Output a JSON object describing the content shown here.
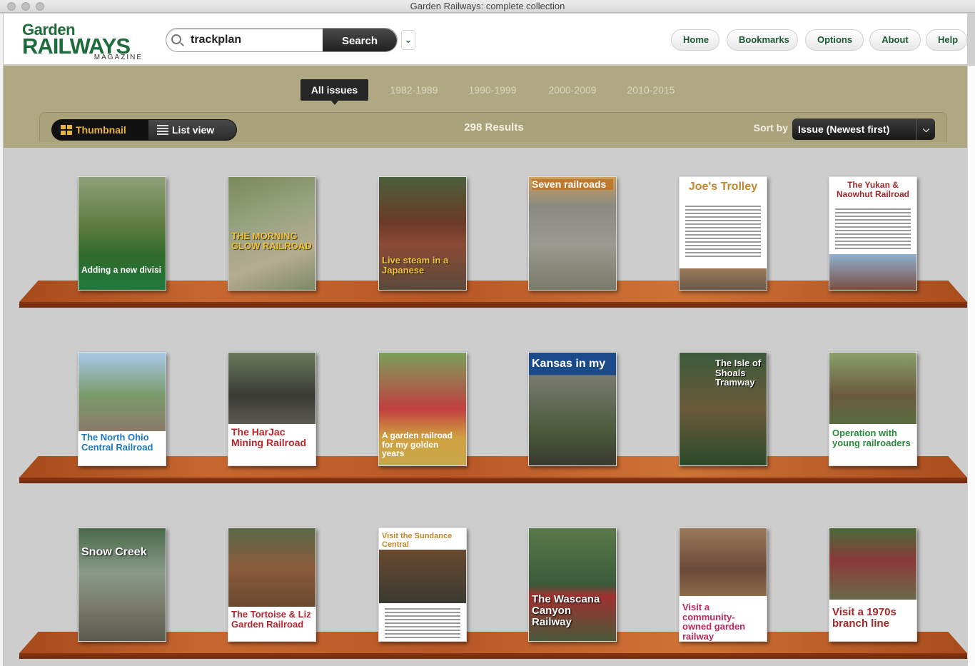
{
  "window": {
    "title": "Garden Railways: complete collection"
  },
  "logo": {
    "line1": "Garden",
    "line2": "RAILWAYS",
    "line3": "MAGAZINE"
  },
  "search": {
    "value": "trackplan",
    "button": "Search",
    "dropdown": "⌄"
  },
  "nav": {
    "home": "Home",
    "bookmarks": "Bookmarks",
    "options": "Options",
    "about": "About",
    "help": "Help"
  },
  "eras": [
    "All issues",
    "1982-1989",
    "1990-1999",
    "2000-2009",
    "2010-2015"
  ],
  "view": {
    "thumbnail": "Thumbnail",
    "list": "List view"
  },
  "results": "298 Results",
  "sort": {
    "label": "Sort by",
    "value": "Issue (Newest first)"
  },
  "books": [
    {
      "title": "Adding a new divisi"
    },
    {
      "title": "THE MORNING GLOW RAILROAD"
    },
    {
      "title": "Live steam in a Japanese"
    },
    {
      "title": "Seven railroads"
    },
    {
      "title": "Joe's Trolley"
    },
    {
      "title": "The Yukan & Naowhut Railroad"
    },
    {
      "title": "The North Ohio Central Railroad"
    },
    {
      "title": "The HarJac Mining Railroad"
    },
    {
      "title": "A garden railroad for my golden years"
    },
    {
      "title": "Kansas in my"
    },
    {
      "title": "The Isle of Shoals Tramway"
    },
    {
      "title": "Operation with young railroaders"
    },
    {
      "title": "Snow Creek"
    },
    {
      "title": "The Tortoise & Liz Garden Railroad"
    },
    {
      "title": "Visit the Sundance Central"
    },
    {
      "title": "The Wascana Canyon Railway"
    },
    {
      "title": "Visit a community-owned garden railway"
    },
    {
      "title": "Visit a 1970s branch line"
    }
  ]
}
